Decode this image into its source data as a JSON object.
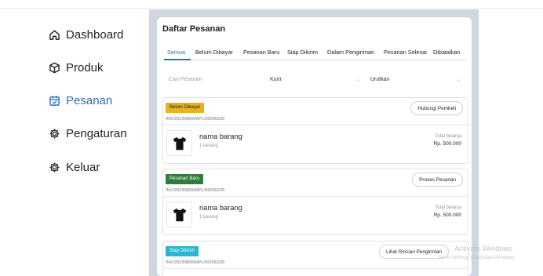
{
  "sidebar": {
    "items": [
      {
        "label": "Dashboard",
        "icon": "home-icon",
        "active": false
      },
      {
        "label": "Produk",
        "icon": "box-icon",
        "active": false
      },
      {
        "label": "Pesanan",
        "icon": "calendar-icon",
        "active": true
      },
      {
        "label": "Pengaturan",
        "icon": "gear-icon",
        "active": false
      },
      {
        "label": "Keluar",
        "icon": "gear-icon",
        "active": false
      }
    ]
  },
  "main": {
    "title": "Daftar Pesanan",
    "tabs": [
      {
        "label": "Semua",
        "active": true
      },
      {
        "label": "Belum Dibayar"
      },
      {
        "label": "Pesanan Baru"
      },
      {
        "label": "Siap Dikirim"
      },
      {
        "label": "Dalam Pengiriman"
      },
      {
        "label": "Pesanan Selesai"
      },
      {
        "label": "Dibatalkan"
      }
    ],
    "filters": {
      "search_placeholder": "Cari Pesanan",
      "courier_label": "Kurir",
      "sort_label": "Urutkan",
      "chevron": "⌄"
    },
    "orders": [
      {
        "status": "Belum Dibayar",
        "status_color": "#e8b321",
        "invoice": "INV/20230809/MPL/00000239",
        "action": "Hubungi Pembeli",
        "item_name": "nama barang",
        "item_qty": "1 barang",
        "total_label": "Total belanja",
        "total_value": "Rp. 500.000"
      },
      {
        "status": "Pesanan Baru",
        "status_color": "#2e7d3a",
        "invoice": "INV/20230809/MPL/00000239",
        "action": "Proses Pesanan",
        "item_name": "nama barang",
        "item_qty": "1 barang",
        "total_label": "Total belanja",
        "total_value": "Rp. 500.000"
      },
      {
        "status": "Siap Dikirim",
        "status_color": "#28b5d6",
        "invoice": "INV/20230809/MPL/00000239",
        "action": "Lihat Rincian Pengiriman"
      }
    ]
  },
  "watermark": {
    "title": "Activate Windows",
    "subtitle": "Go to Settings to activate Windows."
  }
}
